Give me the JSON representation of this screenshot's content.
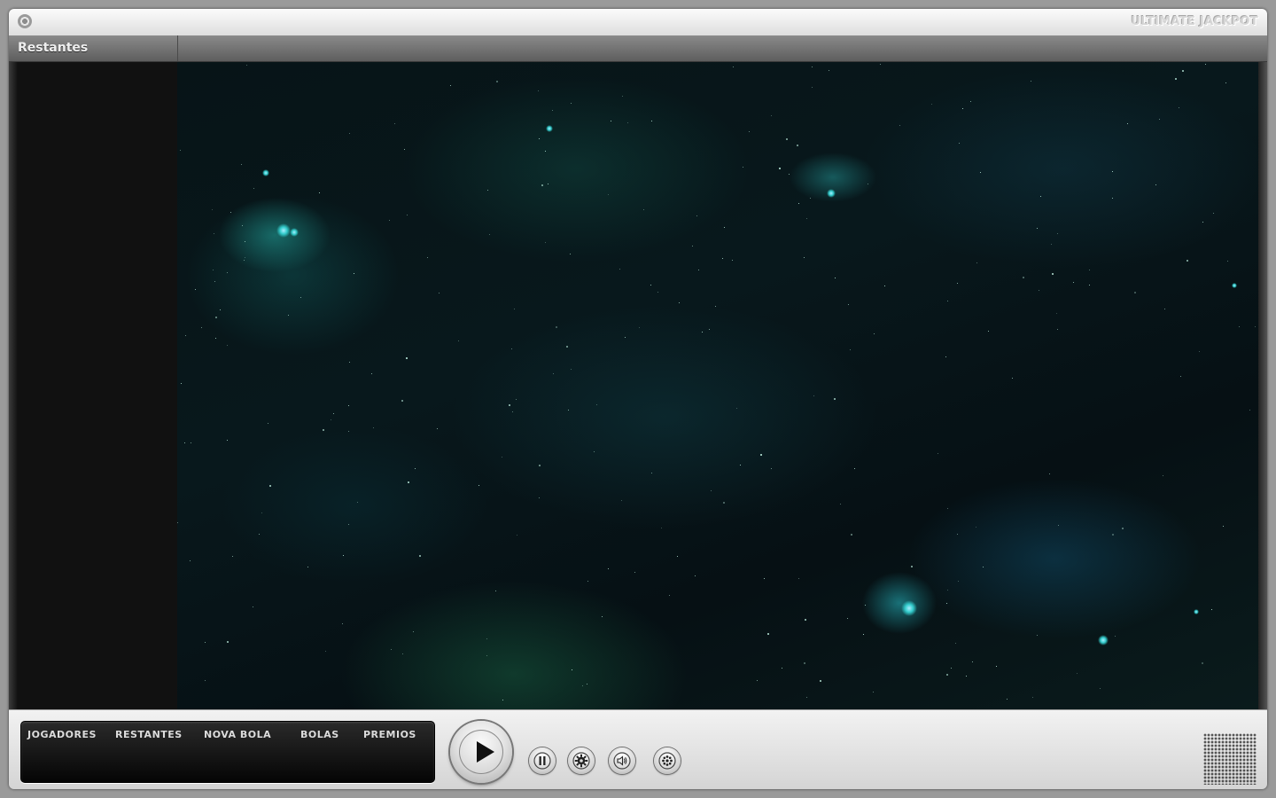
{
  "window": {
    "app_title": "ULTIMATE JACKPOT"
  },
  "left_panel": {
    "title": "Restantes"
  },
  "info_panel": {
    "columns": [
      "JOGADORES",
      "RESTANTES",
      "NOVA BOLA",
      "BOLAS",
      "PREMIOS"
    ]
  },
  "controls": {
    "play_icon": "play-icon",
    "pause_icon": "pause-icon",
    "settings_icon": "gear-icon",
    "volume_icon": "speaker-icon",
    "extra_icon": "snowflake-icon"
  },
  "colors": {
    "chrome": "#d9d9d9",
    "panel_dark": "#111111",
    "space_bg": "#071417",
    "nebula_accent": "#2fb8b0"
  }
}
